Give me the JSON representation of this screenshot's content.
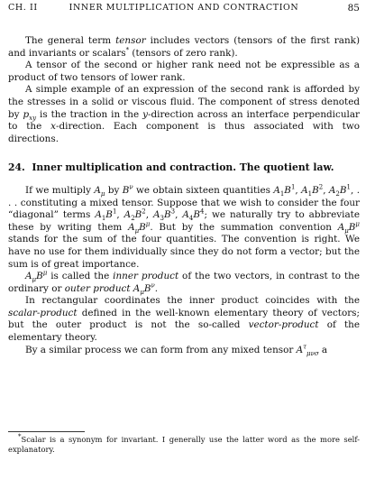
{
  "header": {
    "chapter": "CH. II",
    "title": "INNER MULTIPLICATION AND CONTRACTION",
    "page_number": "85"
  },
  "p1": {
    "a": "The general term ",
    "b": "tensor",
    "c": " includes vectors (tensors of the first rank) and invariants or scalars",
    "d": "*",
    "e": " (tensors of zero rank)."
  },
  "p2": "A tensor of the second or higher rank need not be expressible as a product of two tensors of lower rank.",
  "p3": {
    "a": "A simple example of an expression of the second rank is afforded by the stresses in a solid or viscous fluid.  The component of stress denoted by ",
    "b": "p",
    "c": "xy",
    "d": " is the traction in the ",
    "e": "y",
    "f": "-direction across an interface perpendicular to the ",
    "g": "x",
    "h": "-direction.  Each component is thus associated with two directions."
  },
  "section": {
    "number": "24.",
    "title": "Inner multiplication and contraction.  The quotient law."
  },
  "p4": {
    "a": "If we multiply ",
    "b": "A",
    "c": "μ",
    "d": " by ",
    "e": "B",
    "f": "ν",
    "g": " we obtain sixteen quantities ",
    "h": "A",
    "i": "1",
    "j": "B",
    "k": "1",
    "l": ", ",
    "m": "A",
    "n": "1",
    "o": "B",
    "p": "2",
    "q": ", ",
    "r": "A",
    "s": "2",
    "t": "B",
    "u": "1",
    "v": ", . . . constituting a mixed tensor.  Suppose that we wish to consider the four “diagonal” terms ",
    "w": "A",
    "x": "1",
    "y": "B",
    "z": "1",
    "aa": ", ",
    "ab": "A",
    "ac": "2",
    "ad": "B",
    "ae": "2",
    "af": ", ",
    "ag": "A",
    "ah": "3",
    "ai": "B",
    "aj": "3",
    "ak": ", ",
    "al": "A",
    "am": "4",
    "an": "B",
    "ao": "4",
    "ap": "; we naturally try to abbreviate these by writing them ",
    "aq": "A",
    "ar": "μ",
    "as": "B",
    "at": "μ",
    "au": ". But by the summation convention ",
    "av": "A",
    "aw": "μ",
    "ax": "B",
    "ay": "μ",
    "az": " stands for the sum of the four quantities.  The convention is right.  We have no use for them individually since they do not form a vector; but the sum is of great importance."
  },
  "p5": {
    "a": "A",
    "b": "μ",
    "c": "B",
    "d": "μ",
    "e": " is called the ",
    "f": "inner product",
    "g": " of the two vectors, in contrast to the ordinary or ",
    "h": "outer product A",
    "i": "μ",
    "j": "B",
    "k": "ν",
    "l": "."
  },
  "p6": {
    "a": "In rectangular coordinates the inner product coincides with the ",
    "b": "scalar-product",
    "c": " defined in the well-known elementary theory of vectors; but the outer product is not the so-called ",
    "d": "vector-product",
    "e": " of the elementary theory."
  },
  "p7": {
    "a": "By a similar process we can form from any mixed tensor ",
    "b": "A",
    "c": "τ",
    "d": "μνσ",
    "e": " a"
  },
  "footnote": {
    "mark": "*",
    "text": "Scalar is a synonym for invariant.  I generally use the latter word as the more self-explanatory."
  }
}
